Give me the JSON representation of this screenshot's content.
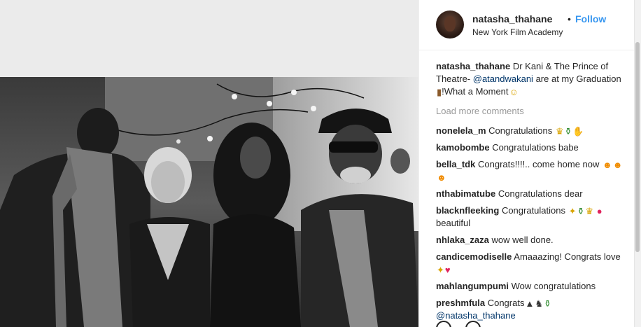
{
  "post": {
    "username": "natasha_thahane",
    "separator": "•",
    "follow_label": "Follow",
    "location": "New York Film Academy",
    "photo_alt": "Black and white group photo of four people at a graduation event"
  },
  "caption": {
    "username": "natasha_thahane",
    "text_before": "Dr Kani & The Prince of Theatre- ",
    "mention": "@atandwakani",
    "text_after": " are at my Graduation ",
    "text_end": "!What a Moment"
  },
  "load_more_label": "Load more comments",
  "comments": [
    {
      "username": "nonelela_m",
      "text": "Congratulations"
    },
    {
      "username": "kamobombe",
      "text": "Congratulations babe"
    },
    {
      "username": "bella_tdk",
      "text": "Congrats!!!!.. come home now"
    },
    {
      "username": "nthabimatube",
      "text": "Congratulations dear"
    },
    {
      "username": "blacknfleeking",
      "text": "Congratulations",
      "text2": " beautiful"
    },
    {
      "username": "nhlaka_zaza",
      "text": "wow well done."
    },
    {
      "username": "candicemodiselle",
      "text": "Amaaazing! Congrats love"
    },
    {
      "username": "mahlangumpumi",
      "text": "Wow congratulations"
    },
    {
      "username": "preshmfula",
      "text": "Congrats",
      "mention": "@natasha_thahane"
    }
  ],
  "icons": {
    "avatar": "profile-avatar",
    "like": "heart-icon",
    "comment": "comment-icon"
  },
  "colors": {
    "follow": "#3897f0",
    "muted": "#999999",
    "mention": "#003569"
  }
}
